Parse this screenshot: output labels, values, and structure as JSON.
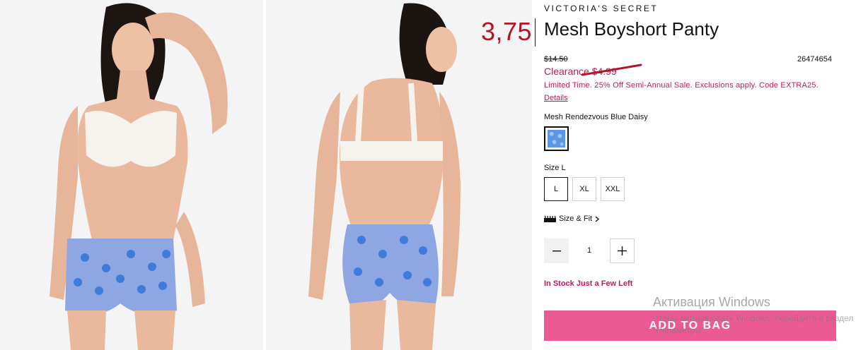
{
  "product": {
    "brand": "VICTORIA'S SECRET",
    "title": "Mesh Boyshort Panty",
    "original_price": "$14.50",
    "sku": "26474654",
    "clearance": "Clearance $4.99",
    "promo": "Limited Time. 25% Off Semi-Annual Sale. Exclusions apply. Code EXTRA25.",
    "details_link": "Details",
    "color_name": "Mesh Rendezvous Blue Daisy",
    "size_label": "Size L",
    "sizes": [
      "L",
      "XL",
      "XXL"
    ],
    "selected_size": "L",
    "size_fit": "Size & Fit",
    "quantity": "1",
    "stock_status": "In Stock Just a Few Left",
    "add_to_bag": "ADD TO BAG"
  },
  "overlay": {
    "handwritten_price": "3,75"
  },
  "windows_watermark": {
    "title": "Активация Windows",
    "subtitle": "Чтобы активировать Windows, перейдите в раздел \"Параметры\"."
  },
  "colors": {
    "accent_pink": "#c2185b",
    "button_pink": "#ec5a93",
    "overlay_red": "#b0152a",
    "swatch_blue": "#5c97e6"
  },
  "icons": {
    "ruler": "ruler-icon",
    "chevron": "chevron-right-icon",
    "minus": "minus-icon",
    "plus": "plus-icon"
  }
}
